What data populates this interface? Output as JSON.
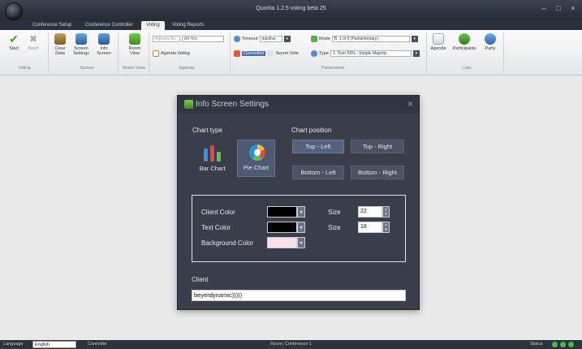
{
  "window": {
    "title": "Quorita 1.2.5 voting beta 25",
    "controls": [
      "–",
      "□",
      "×"
    ]
  },
  "tabs": [
    "Conference Setup",
    "Conference Controller",
    "Voting",
    "Voting Reports"
  ],
  "active_tab": "Voting",
  "ribbon": {
    "voting": {
      "start": "Start",
      "abort": "Abort",
      "group": "Voting"
    },
    "screen": {
      "clear": "Clear Data",
      "settings": "Screen Settings",
      "info": "Info Screen",
      "group": "Screen"
    },
    "room": {
      "view": "Room View",
      "group": "Room View"
    },
    "agenda": {
      "no_placeholder": "Agenda No.",
      "title_value": "Ad Hoc",
      "voting_label": "Agenda Voting",
      "group": "Agenda"
    },
    "parameters": {
      "timeout_label": "Timeout",
      "timeout_value": "inactive",
      "mode_label": "Mode",
      "mode_value": "B. 1 of 3 (Parliamentary)",
      "correction_label": "Correction",
      "secret_label": "Secret Vote",
      "type_label": "Type",
      "type_value": "1. Over 50% - Simple Majority",
      "group": "Parameters"
    },
    "lists": {
      "agenda": "Agenda",
      "participants": "Participants",
      "party": "Party",
      "group": "Lists"
    }
  },
  "dialog": {
    "title": "Info Screen Settings",
    "close": "×",
    "chart_type_label": "Chart type",
    "chart_types": [
      "Bar Chart",
      "Pie Chart"
    ],
    "selected_chart_type": "Pie Chart",
    "chart_position_label": "Chart position",
    "positions": [
      "Top - Left",
      "Top - Right",
      "Bottom - Left",
      "Bottom - Right"
    ],
    "selected_position": "Top - Left",
    "client_color_label": "Client Color",
    "text_color_label": "Text Color",
    "background_color_label": "Background Color",
    "size_label": "Size",
    "client_size": "22",
    "text_size": "18",
    "client_label": "Client",
    "client_value": "beyerdynamic)))))",
    "colors": {
      "client": "#000000",
      "text": "#000000",
      "background": "#f6dfe6"
    }
  },
  "status": {
    "language_label": "Language",
    "language_value": "English",
    "mode": "Controller",
    "center": "Room: Conference 1",
    "right": "Status"
  }
}
